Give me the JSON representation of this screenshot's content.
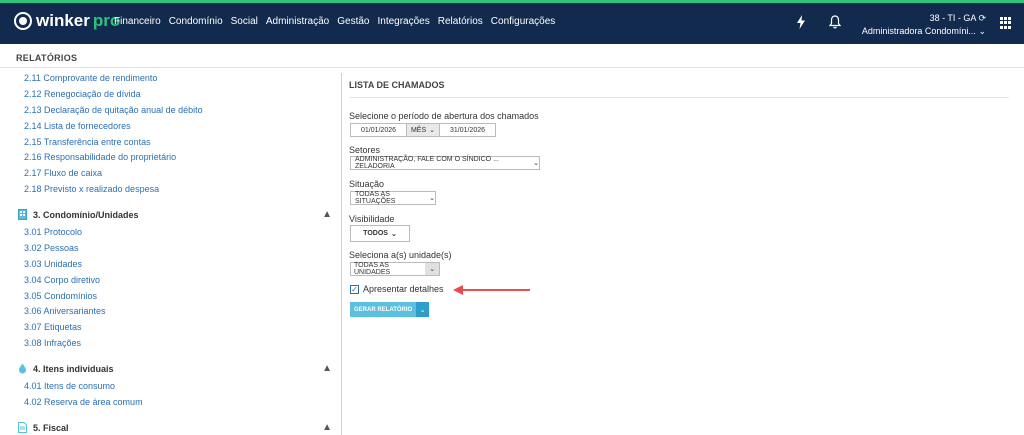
{
  "brand": {
    "name": "winker",
    "suffix": "pro"
  },
  "nav": [
    "Financeiro",
    "Condomínio",
    "Social",
    "Administração",
    "Gestão",
    "Integrações",
    "Relatórios",
    "Configurações"
  ],
  "user": {
    "line1": "38 - TI - GA",
    "line2": "Administradora Condomíni..."
  },
  "colors": {
    "topbar": "#132a4f",
    "accent_green": "#2fc27a",
    "link": "#2b6fb3",
    "button": "#5bc0de",
    "arrow": "#e84c4c"
  },
  "page_title": "RELATÓRIOS",
  "sidebar": {
    "top_links": [
      "2.11 Comprovante de rendimento",
      "2.12 Renegociação de dívida",
      "2.13 Declaração de quitação anual de débito",
      "2.14 Lista de fornecedores",
      "2.15 Transferência entre contas",
      "2.16 Responsabilidade do proprietário",
      "2.17 Fluxo de caixa",
      "2.18 Previsto x realizado despesa"
    ],
    "sections": [
      {
        "title": "3. Condomínio/Unidades",
        "icon": "building-icon",
        "links": [
          "3.01 Protocolo",
          "3.02 Pessoas",
          "3.03 Unidades",
          "3.04 Corpo diretivo",
          "3.05 Condomínios",
          "3.06 Aniversariantes",
          "3.07 Etiquetas",
          "3.08 Infrações"
        ]
      },
      {
        "title": "4. Itens individuais",
        "icon": "water-drop-icon",
        "links": [
          "4.01 Itens de consumo",
          "4.02 Reserva de área comum"
        ]
      },
      {
        "title": "5. Fiscal",
        "icon": "document-icon",
        "links": []
      }
    ]
  },
  "main": {
    "title": "LISTA DE CHAMADOS",
    "period_label": "Selecione o período de abertura dos chamados",
    "date_start": "01/01/2026",
    "period_mode": "MÊS",
    "date_end": "31/01/2026",
    "sectors_label": "Setores",
    "sectors_value": "ADMINISTRAÇÃO, FALE COM O SÍNDICO ... ZELADORIA",
    "situation_label": "Situação",
    "situation_value": "TODAS AS SITUAÇÕES",
    "visibility_label": "Visibilidade",
    "visibility_value": "TODOS",
    "units_label": "Seleciona a(s) unidade(s)",
    "units_value": "TODAS AS UNIDADES",
    "details_label": "Apresentar detalhes",
    "details_checked": true,
    "generate_label": "GERAR RELATÓRIO"
  }
}
